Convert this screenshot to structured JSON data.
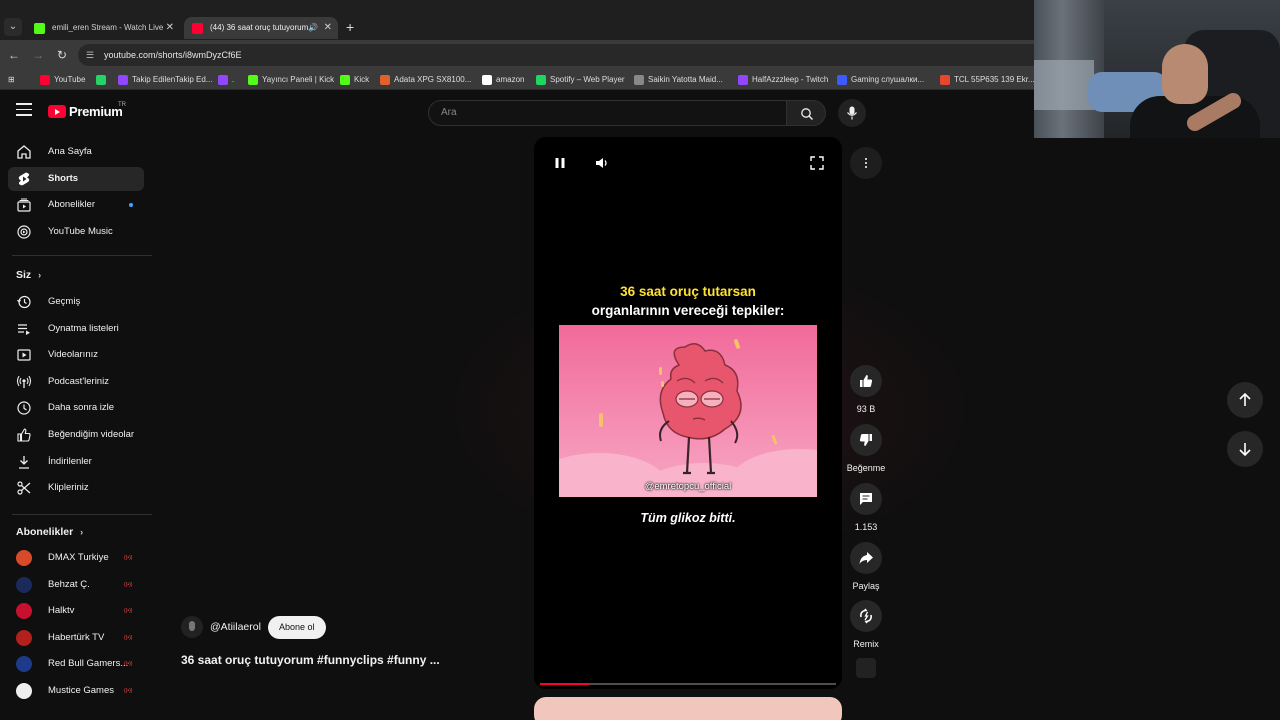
{
  "browser": {
    "tabs": [
      {
        "title": "emili_eren Stream - Watch Live",
        "color": "#53fc18"
      },
      {
        "title": "(44) 36 saat oruç tutuyorum",
        "color": "#ff0033"
      }
    ],
    "new_tab": "+",
    "url": "youtube.com/shorts/i8wmDyzCf6E",
    "bookmarks": [
      {
        "label": "YouTube",
        "color": "#ff0033"
      },
      {
        "label": "",
        "color": "#25d366"
      },
      {
        "label": "Takip EdilenTakip Ed...",
        "color": "#9146ff"
      },
      {
        "label": ".",
        "color": "#9146ff"
      },
      {
        "label": "Yayıncı Paneli | Kick",
        "color": "#53fc18"
      },
      {
        "label": "Kick",
        "color": "#53fc18"
      },
      {
        "label": "Adata XPG SX8100...",
        "color": "#e0612b"
      },
      {
        "label": "amazon",
        "color": "#ffffff"
      },
      {
        "label": "Spotify – Web Player",
        "color": "#1ed760"
      },
      {
        "label": "Saikin Yatotta Maid...",
        "color": "#888888"
      },
      {
        "label": "HalfAzzzleep - Twitch",
        "color": "#9146ff"
      },
      {
        "label": "Gaming слушалки...",
        "color": "#3b5bff"
      },
      {
        "label": "TCL 55P635 139 Ekr...",
        "color": "#e8462d"
      }
    ]
  },
  "header": {
    "brand": "Premium",
    "region": "TR",
    "search_placeholder": "Ara"
  },
  "sidebar": {
    "main": [
      {
        "label": "Ana Sayfa",
        "icon": "home-icon"
      },
      {
        "label": "Shorts",
        "icon": "shorts-icon",
        "active": true
      },
      {
        "label": "Abonelikler",
        "icon": "subscriptions-icon",
        "dot": true
      },
      {
        "label": "YouTube Music",
        "icon": "youtube-music-icon"
      }
    ],
    "you_title": "Siz",
    "you": [
      {
        "label": "Geçmiş",
        "icon": "history-icon"
      },
      {
        "label": "Oynatma listeleri",
        "icon": "playlists-icon"
      },
      {
        "label": "Videolarınız",
        "icon": "your-videos-icon"
      },
      {
        "label": "Podcast'leriniz",
        "icon": "podcast-icon"
      },
      {
        "label": "Daha sonra izle",
        "icon": "watch-later-icon"
      },
      {
        "label": "Beğendiğim videolar",
        "icon": "liked-icon"
      },
      {
        "label": "İndirilenler",
        "icon": "download-icon"
      },
      {
        "label": "Klipleriniz",
        "icon": "clips-icon"
      }
    ],
    "subs_title": "Abonelikler",
    "subs": [
      {
        "label": "DMAX Turkiye",
        "color": "#d94a2b"
      },
      {
        "label": "Behzat Ç.",
        "color": "#1a2a5a"
      },
      {
        "label": "Halktv",
        "color": "#c8102e"
      },
      {
        "label": "Habertürk TV",
        "color": "#b3201c"
      },
      {
        "label": "Red Bull Gamers...",
        "color": "#1e3a8a"
      },
      {
        "label": "Mustice Games",
        "color": "#eeeeee"
      }
    ]
  },
  "player": {
    "caption_line1": "36 saat oruç tutarsan",
    "caption_line2": "organlarının vereceği tepkiler:",
    "watermark": "@emretopcu_official",
    "subtitle": "Tüm glikoz bitti.",
    "progress": 0.17
  },
  "actions": {
    "like_count": "93 B",
    "dislike_label": "Beğenme",
    "comment_count": "1.153",
    "share_label": "Paylaş",
    "remix_label": "Remix"
  },
  "channel": {
    "handle": "@Atiilaerol",
    "subscribe_label": "Abone ol"
  },
  "short_title": "36 saat oruç tutuyorum #funnyclips #funny ..."
}
